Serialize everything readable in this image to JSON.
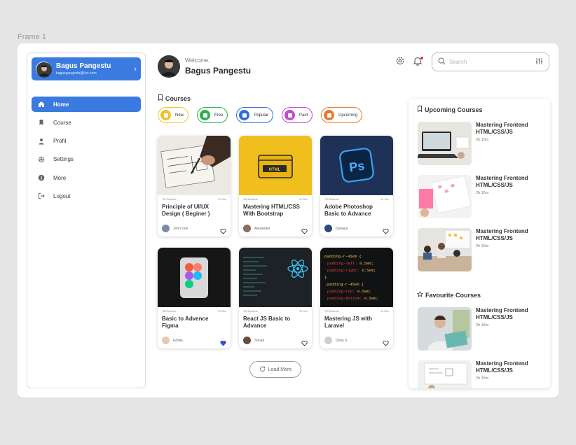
{
  "frame_label": "Frame 1",
  "sidebar": {
    "user_name": "Bagus Pangestu",
    "user_email": "baguspangestu@live.com",
    "menu": [
      {
        "label": "Home",
        "icon": "home-icon",
        "active": true
      },
      {
        "label": "Course",
        "icon": "bookmark-icon",
        "active": false
      },
      {
        "label": "Profil",
        "icon": "user-icon",
        "active": false
      },
      {
        "label": "Settings",
        "icon": "gear-icon",
        "active": false
      },
      {
        "label": "More",
        "icon": "info-icon",
        "active": false
      },
      {
        "label": "Logout",
        "icon": "logout-icon",
        "active": false
      }
    ]
  },
  "header": {
    "welcome": "Welcome,",
    "name": "Bagus Pangestu",
    "search_placeholder": "Search"
  },
  "courses": {
    "title": "Courses",
    "filters": [
      {
        "label": "New",
        "color": "#f2c12e"
      },
      {
        "label": "Free",
        "color": "#2bb24c"
      },
      {
        "label": "Popular",
        "color": "#2f6fd6"
      },
      {
        "label": "Paid",
        "color": "#c54ad3"
      },
      {
        "label": "Upcoming",
        "color": "#e67a2e"
      }
    ],
    "cards": [
      {
        "title": "Principle of UI/UX Design ( Beginer )",
        "students": "799 Students",
        "duration": "2h 10m",
        "tutor": "John Doe",
        "favorite": false
      },
      {
        "title": "Mastering HTML/CSS With Bootstrap",
        "students": "768 Students",
        "duration": "2h 20m",
        "tutor": "Alexander",
        "favorite": false
      },
      {
        "title": "Adobe Photoshop Basic to Advance",
        "students": "799 Students",
        "duration": "2h 15m",
        "tutor": "Dunaya",
        "favorite": false
      },
      {
        "title": "Basic to Advence Figma",
        "students": "768 Students",
        "duration": "2h 05m",
        "tutor": "Emilia",
        "favorite": true
      },
      {
        "title": "React JS Basic to Advance",
        "students": "768 Students",
        "duration": "2h 10m",
        "tutor": "Sonya",
        "favorite": false
      },
      {
        "title": "Mastering JS with Laravel",
        "students": "799 Students",
        "duration": "2h 30m",
        "tutor": "Dony S",
        "favorite": false
      }
    ],
    "load_more": "Load More"
  },
  "panel": {
    "upcoming_title": "Upcoming Courses",
    "upcoming": [
      {
        "title": "Mastering Frontend HTML/CSS/JS",
        "duration": "2h 15m"
      },
      {
        "title": "Mastering Frontend HTML/CSS/JS",
        "duration": "2h 15m"
      },
      {
        "title": "Mastering Frontend HTML/CSS/JS",
        "duration": "2h 15m"
      }
    ],
    "favourite_title": "Favourite Courses",
    "favourite": [
      {
        "title": "Mastering Frontend HTML/CSS/JS",
        "duration": "2h 15m"
      },
      {
        "title": "Mastering Frontend HTML/CSS/JS",
        "duration": "2h 15m"
      }
    ]
  },
  "colors": {
    "accent": "#3b7be0",
    "favorite_heart": "#3b4fd8"
  }
}
